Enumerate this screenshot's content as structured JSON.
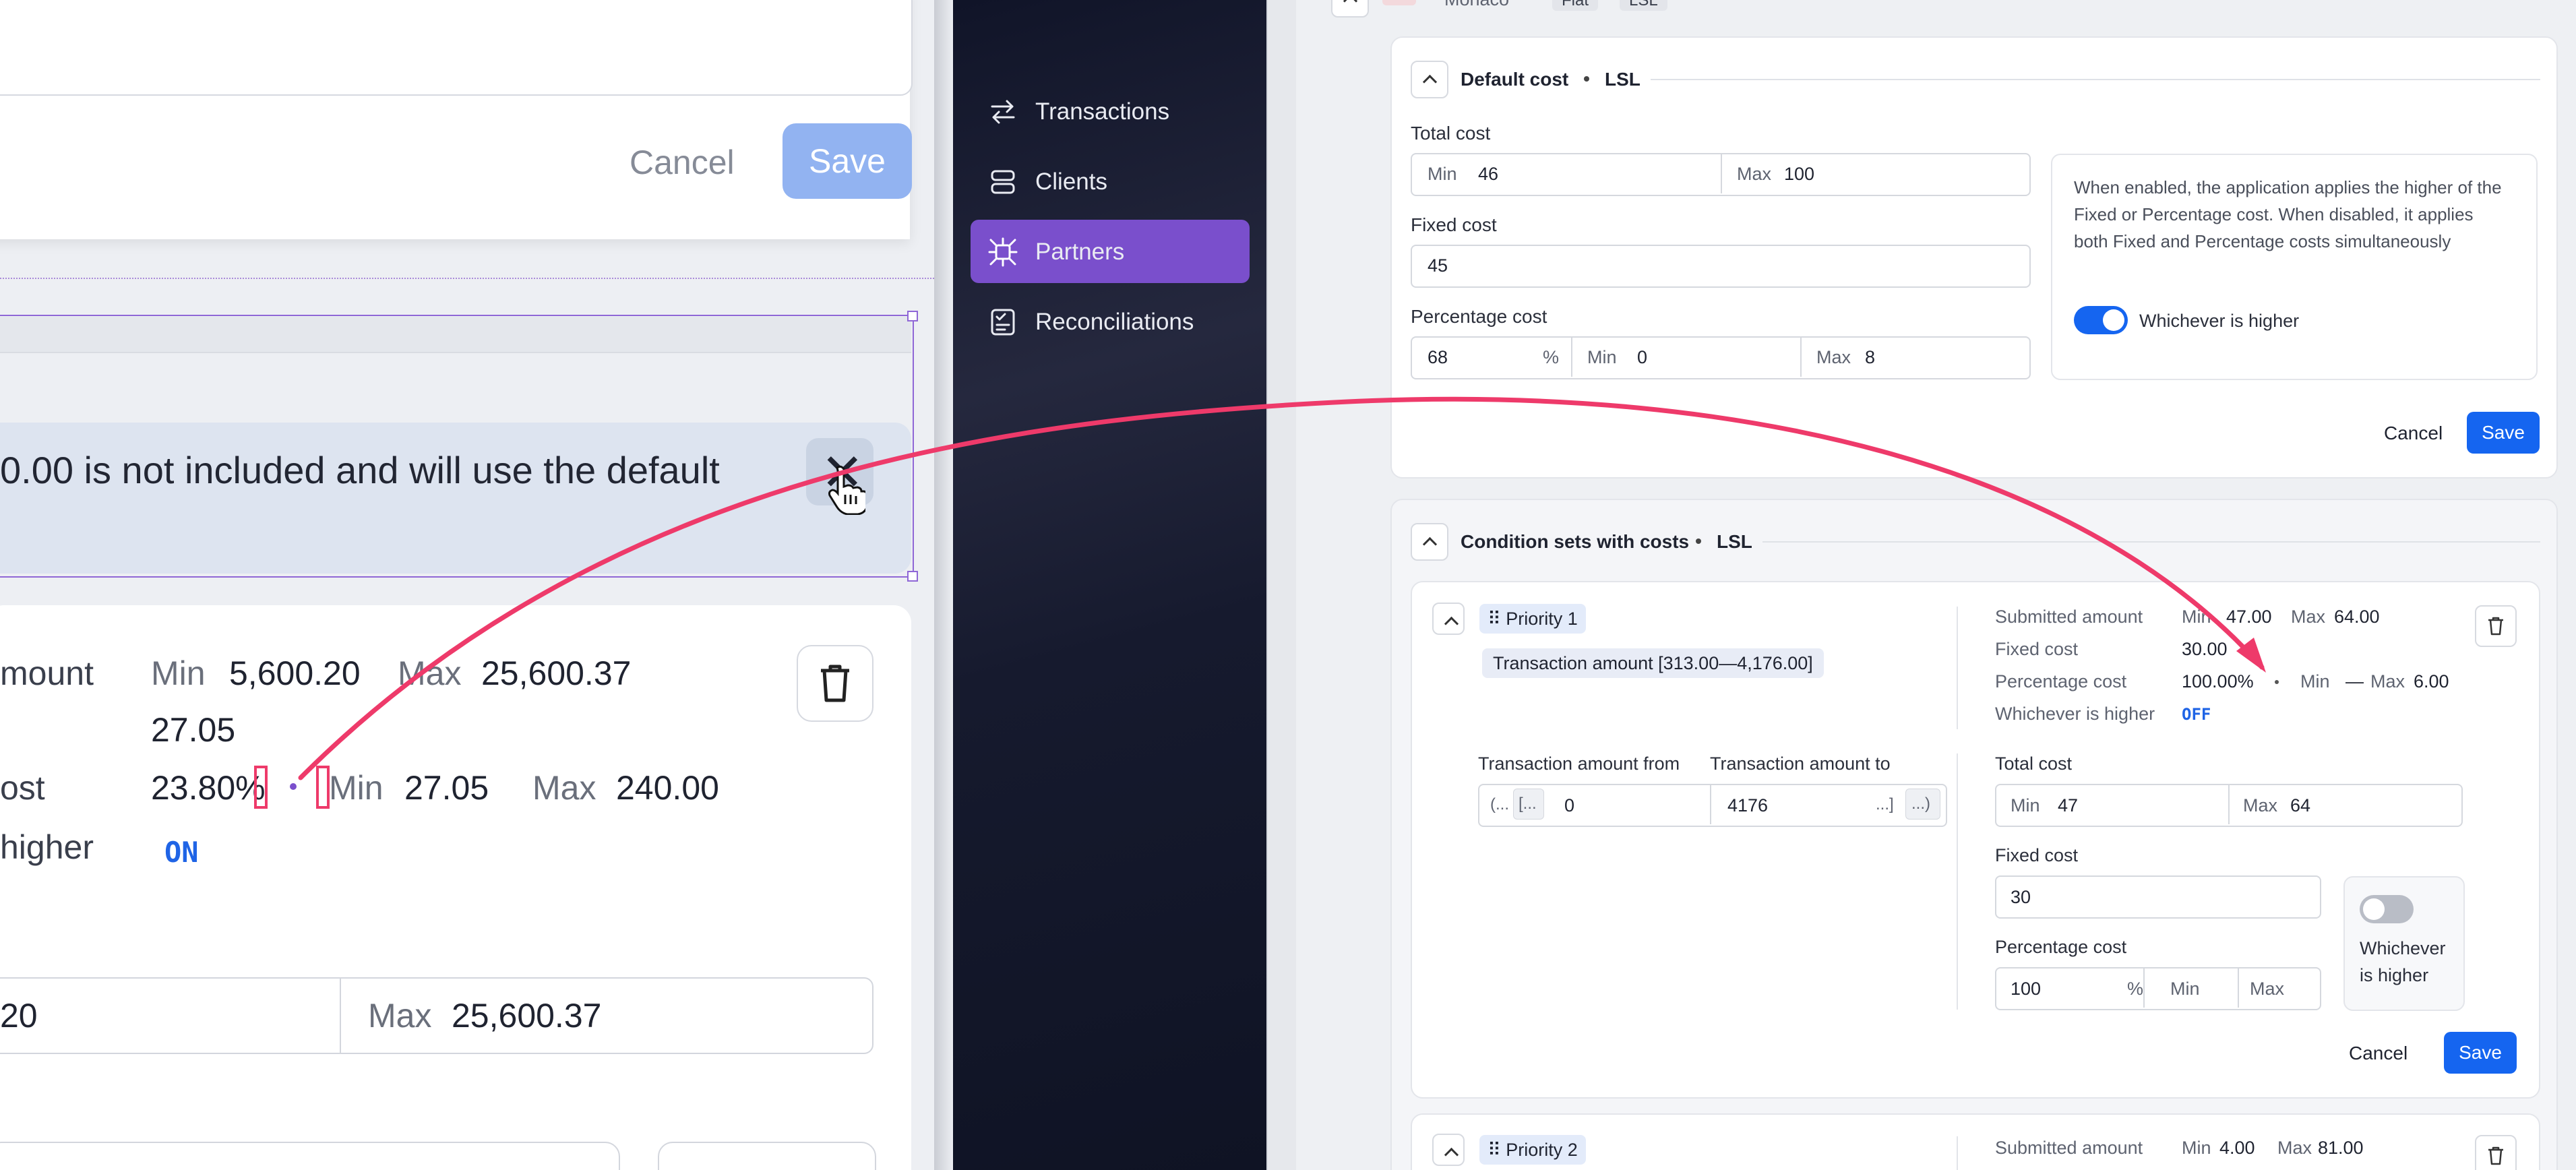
{
  "left_panel": {
    "cancel_label": "Cancel",
    "save_label": "Save",
    "banner_text": "0.00 is not included and will use the default",
    "close_glyph": "✕",
    "amount_label": "mount",
    "amount_min_label": "Min",
    "amount_min": "5,600.20",
    "amount_max_label": "Max",
    "amount_max": "25,600.37",
    "fixed_value": "27.05",
    "pct_label": "ost",
    "pct_value": "23.80%",
    "pct_min_label": "Min",
    "pct_min": "27.05",
    "pct_max_label": "Max",
    "pct_max": "240.00",
    "higher_label": "higher",
    "higher_state": "ON",
    "range_min_value": "20",
    "range_max_label": "Max",
    "range_max_value": "25,600.37"
  },
  "sidebar": {
    "items": [
      {
        "label": "Transactions",
        "icon": "arrows-swap-icon",
        "active": false
      },
      {
        "label": "Clients",
        "icon": "stack-icon",
        "active": false
      },
      {
        "label": "Partners",
        "icon": "network-icon",
        "active": true
      },
      {
        "label": "Reconciliations",
        "icon": "checklist-icon",
        "active": false
      }
    ]
  },
  "top_crumb": {
    "name": "Monaco",
    "tag1": "Flat",
    "tag2": "LSL"
  },
  "default_cost": {
    "title": "Default cost",
    "currency": "LSL",
    "total_label": "Total cost",
    "total_min_label": "Min",
    "total_min": "46",
    "total_max_label": "Max",
    "total_max": "100",
    "fixed_label": "Fixed cost",
    "fixed_value": "45",
    "pct_label": "Percentage cost",
    "pct_value": "68",
    "pct_unit": "%",
    "pct_min_label": "Min",
    "pct_min": "0",
    "pct_max_label": "Max",
    "pct_max": "8",
    "info_text": "When enabled, the application applies the higher of the Fixed or Percentage cost. When disabled, it applies both Fixed and Percentage costs simultaneously",
    "toggle_label": "Whichever is higher",
    "cancel_label": "Cancel",
    "save_label": "Save"
  },
  "condition_sets": {
    "title": "Condition sets with costs",
    "currency": "LSL",
    "priority1": {
      "label": "Priority 1",
      "range_chip": "Transaction amount [313.00—4,176.00]",
      "submitted_label": "Submitted amount",
      "submitted_min_label": "Min",
      "submitted_min": "47.00",
      "submitted_max_label": "Max",
      "submitted_max": "64.00",
      "fixed_label": "Fixed cost",
      "fixed_value": "30.00",
      "pct_label": "Percentage cost",
      "pct_value": "100.00%",
      "pct_min_label": "Min",
      "pct_min_value": "—",
      "pct_max_label": "Max",
      "pct_max_value": "6.00",
      "higher_label": "Whichever is higher",
      "higher_state": "OFF",
      "from_label": "Transaction amount from",
      "from_bracket": "(...",
      "from_chip": "[...",
      "from_value": "0",
      "to_label": "Transaction amount to",
      "to_value": "4176",
      "to_bracket": "...]",
      "to_chip": "...)",
      "total_label": "Total cost",
      "total_min_label": "Min",
      "total_min": "47",
      "total_max_label": "Max",
      "total_max": "64",
      "edit_fixed_label": "Fixed cost",
      "edit_fixed_value": "30",
      "edit_pct_label": "Percentage cost",
      "edit_pct_value": "100",
      "edit_pct_unit": "%",
      "edit_pct_min_label": "Min",
      "edit_pct_max_label": "Max",
      "toggle_label_line1": "Whichever",
      "toggle_label_line2": "is higher",
      "cancel_label": "Cancel",
      "save_label": "Save"
    },
    "priority2": {
      "label": "Priority 2",
      "submitted_label": "Submitted amount",
      "submitted_min_label": "Min",
      "submitted_min": "4.00",
      "submitted_max_label": "Max",
      "submitted_max": "81.00"
    }
  },
  "colors": {
    "accent": "#1565f0",
    "sidebar_active": "#7a4fcc",
    "annotation": "#ee3a6a"
  }
}
